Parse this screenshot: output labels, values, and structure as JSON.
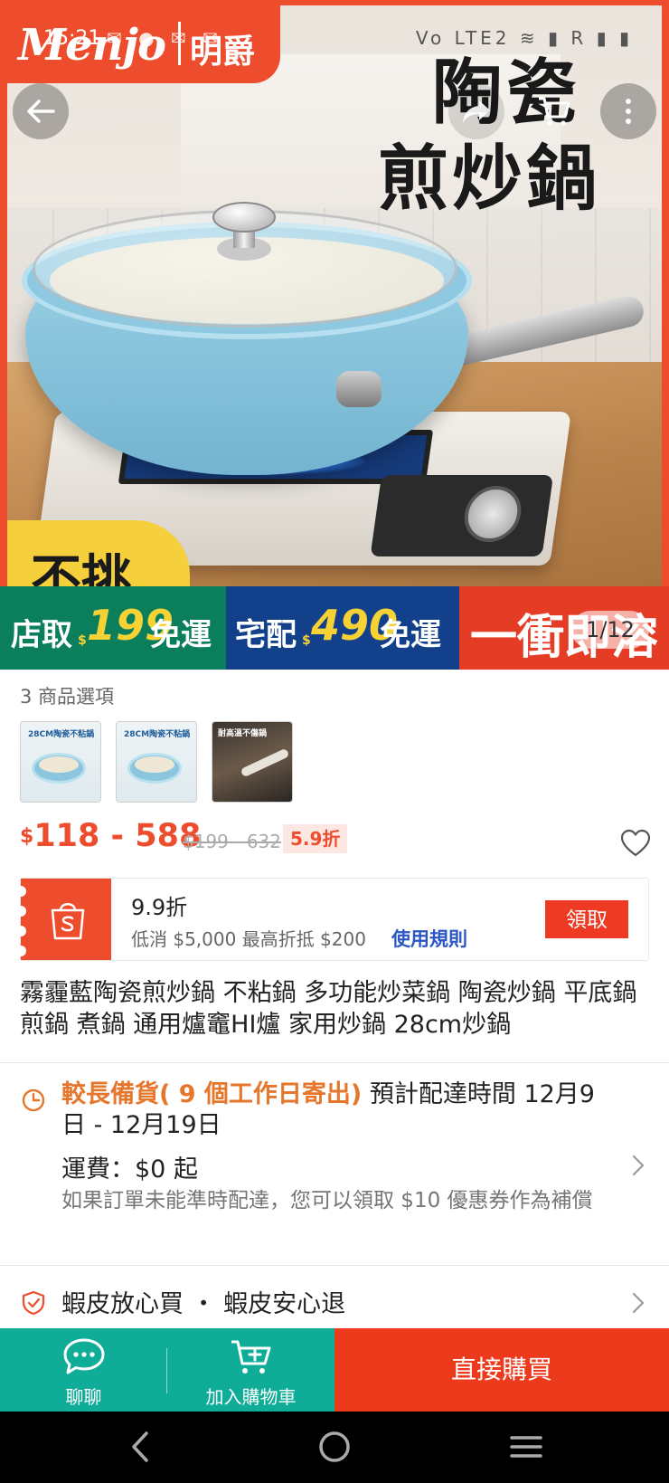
{
  "status_bar": {
    "time": "15:21",
    "left_icons": "✉ ● ✉ ✉",
    "right_icons": "Vo LTE2 ≋ ▮ R ▮ ▮"
  },
  "hero": {
    "brand_logo": "Menjo",
    "brand_cn": "明爵",
    "title_line1": "陶瓷",
    "title_line2": "煎炒鍋",
    "tag_text": "不挑",
    "promo": {
      "pickup_label": "店取",
      "pickup_currency": "$",
      "pickup_amount": "199",
      "pickup_suffix": "免運",
      "delivery_label": "宅配",
      "delivery_currency": "$",
      "delivery_amount": "490",
      "delivery_suffix": "免運",
      "slogan": "一衝即溶"
    },
    "page_indicator": "1/12"
  },
  "variants": {
    "label": "3 商品選項",
    "items": [
      {
        "caption": "28CM陶瓷不粘鍋"
      },
      {
        "caption": "28CM陶瓷不粘鍋"
      },
      {
        "caption": "耐高溫不傷鍋"
      }
    ]
  },
  "pricing": {
    "currency": "$",
    "range": "118 - 588",
    "original": "$199 - 632",
    "discount": "5.9折"
  },
  "voucher": {
    "title": "9.9折",
    "desc": "低消 $5,000 最高折抵 $200",
    "rules_link": "使用規則",
    "claim_label": "領取"
  },
  "product_title": "霧霾藍陶瓷煎炒鍋 不粘鍋 多功能炒菜鍋 陶瓷炒鍋 平底鍋 煎鍋 煮鍋 通用爐竈HI爐 家用炒鍋 28cm炒鍋",
  "shipping": {
    "highlight": "較長備貨( 9 個工作日寄出)",
    "eta": " 預計配達時間 12月9日 - 12月19日",
    "fee": "運費：$0 起",
    "note": "如果訂單未能準時配達，您可以領取 $10 優惠券作為補償"
  },
  "guarantee": {
    "text": "蝦皮放心買 ・ 蝦皮安心退"
  },
  "bottom_bar": {
    "chat_label": "聊聊",
    "cart_label": "加入購物車",
    "buy_label": "直接購買"
  },
  "colors": {
    "shopee_orange": "#ee4d2d",
    "teal": "#0fac98",
    "link_blue": "#2a56c6",
    "ship_orange": "#e6762b"
  }
}
